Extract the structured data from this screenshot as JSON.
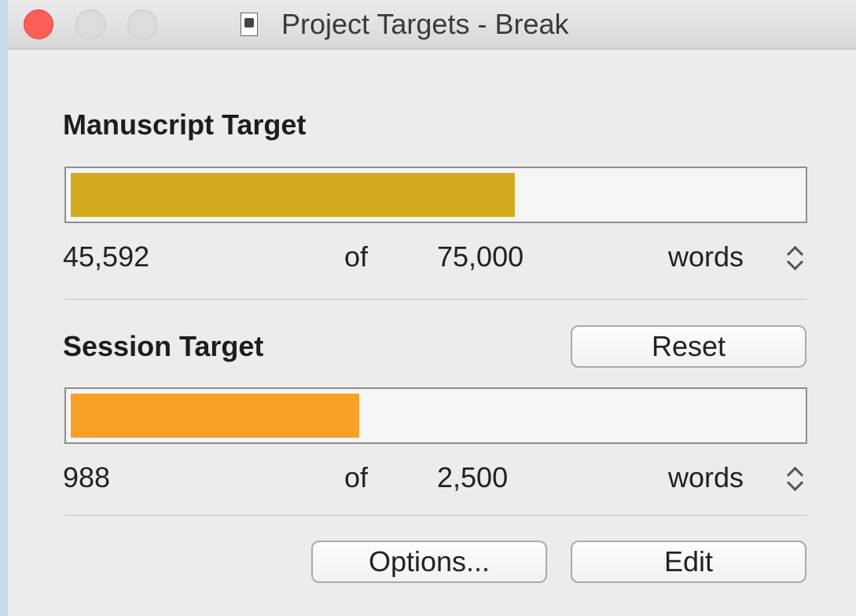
{
  "window": {
    "title": "Project Targets - Break"
  },
  "manuscript": {
    "heading": "Manuscript Target",
    "current": "45,592",
    "of": "of",
    "target": "75,000",
    "unit": "words",
    "progress": 0.608,
    "bar_color": "#d4ab1f"
  },
  "session": {
    "heading": "Session Target",
    "reset_label": "Reset",
    "current": "988",
    "of": "of",
    "target": "2,500",
    "unit": "words",
    "progress": 0.395,
    "bar_color": "#f8a027"
  },
  "footer": {
    "options_label": "Options...",
    "edit_label": "Edit"
  },
  "icons": {
    "close": "close-icon",
    "minimize": "minimize-icon",
    "maximize": "maximize-icon",
    "document": "document-icon",
    "stepper": "chevron-updown-icon"
  }
}
